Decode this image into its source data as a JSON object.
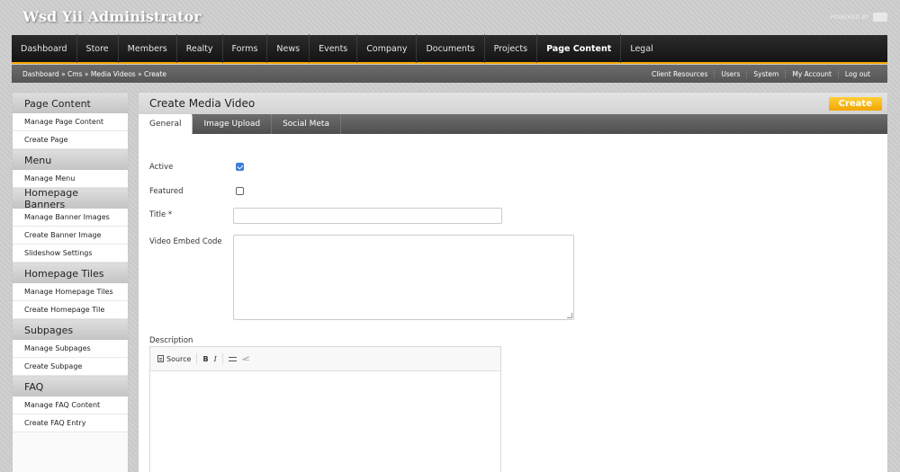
{
  "app": {
    "title": "Wsd Yii Administrator",
    "powered_by": "POWERED BY"
  },
  "topnav": [
    {
      "label": "Dashboard"
    },
    {
      "label": "Store"
    },
    {
      "label": "Members"
    },
    {
      "label": "Realty"
    },
    {
      "label": "Forms"
    },
    {
      "label": "News"
    },
    {
      "label": "Events"
    },
    {
      "label": "Company"
    },
    {
      "label": "Documents"
    },
    {
      "label": "Projects"
    },
    {
      "label": "Page Content",
      "active": true
    },
    {
      "label": "Legal"
    }
  ],
  "breadcrumb": "Dashboard » Cms » Media Videos » Create",
  "utility_links": [
    {
      "label": "Client Resources"
    },
    {
      "label": "Users"
    },
    {
      "label": "System"
    },
    {
      "label": "My Account"
    },
    {
      "label": "Log out"
    }
  ],
  "sidebar": [
    {
      "heading": "Page Content",
      "links": [
        "Manage Page Content",
        "Create Page"
      ]
    },
    {
      "heading": "Menu",
      "links": [
        "Manage Menu"
      ]
    },
    {
      "heading": "Homepage Banners",
      "links": [
        "Manage Banner Images",
        "Create Banner Image",
        "Slideshow Settings"
      ]
    },
    {
      "heading": "Homepage Tiles",
      "links": [
        "Manage Homepage Tiles",
        "Create Homepage Tile"
      ]
    },
    {
      "heading": "Subpages",
      "links": [
        "Manage Subpages",
        "Create Subpage"
      ]
    },
    {
      "heading": "FAQ",
      "links": [
        "Manage FAQ Content",
        "Create FAQ Entry"
      ]
    }
  ],
  "main": {
    "title": "Create Media Video",
    "create_button": "Create",
    "tabs": [
      {
        "label": "General",
        "active": true
      },
      {
        "label": "Image Upload"
      },
      {
        "label": "Social Meta"
      }
    ]
  },
  "form": {
    "active_label": "Active",
    "active_checked": true,
    "featured_label": "Featured",
    "featured_checked": false,
    "title_label": "Title *",
    "title_value": "",
    "embed_label": "Video Embed Code",
    "embed_value": "",
    "description_label": "Description",
    "editor_toolbar": {
      "source": "Source",
      "bold": "B",
      "italic": "I"
    }
  },
  "colors": {
    "accent": "#f5a600",
    "nav_bg": "#1c1c1c",
    "checkbox": "#3b7ddd"
  }
}
